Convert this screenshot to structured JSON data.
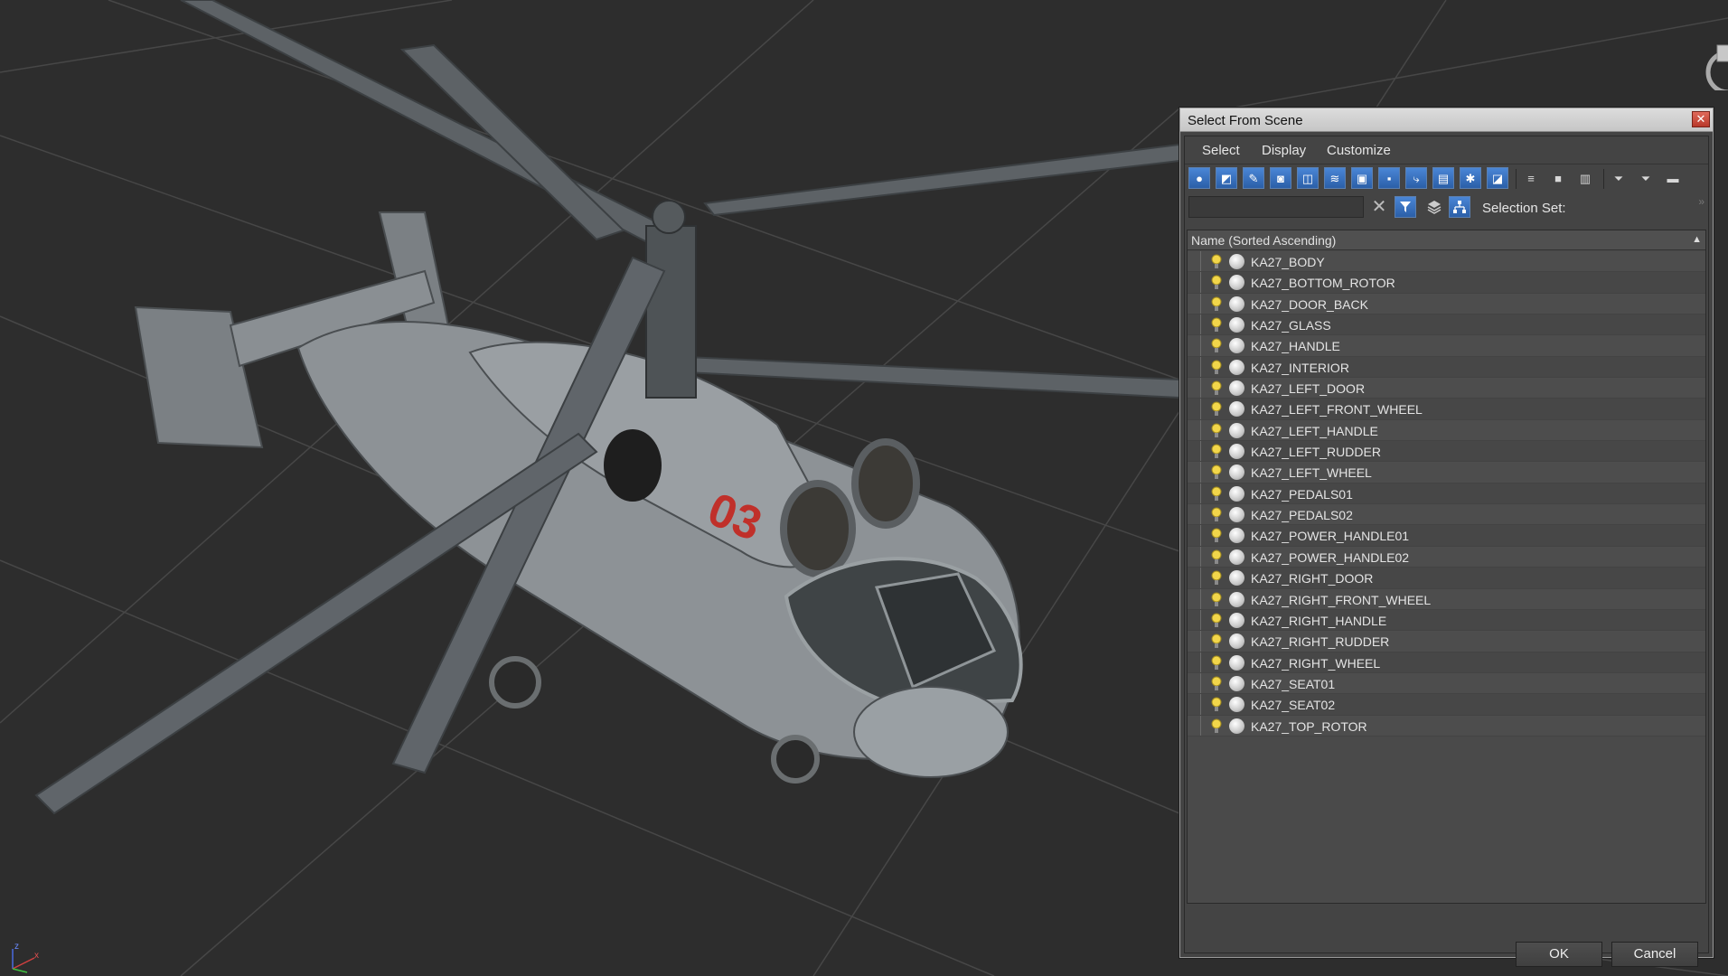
{
  "dialog": {
    "title": "Select From Scene",
    "close_glyph": "✕",
    "menu": [
      "Select",
      "Display",
      "Customize"
    ],
    "toolbar_icons": [
      "geometry-filter-icon",
      "shapes-filter-icon",
      "lights-filter-icon",
      "cameras-filter-icon",
      "helpers-filter-icon",
      "spacewarps-filter-icon",
      "groups-filter-icon",
      "xrefs-filter-icon",
      "bones-filter-icon",
      "containers-filter-icon",
      "frozen-filter-icon",
      "hidden-filter-icon",
      "select-all-icon",
      "select-none-icon",
      "select-invert-icon",
      "filter-icon",
      "filter-options-icon",
      "hierarchy-view-icon"
    ],
    "search_value": "",
    "clear_glyph": "✕",
    "selection_set_label": "Selection Set:",
    "more_glyph": "»",
    "list_header": "Name (Sorted Ascending)",
    "sort_glyph": "▲",
    "objects": [
      "KA27_BODY",
      "KA27_BOTTOM_ROTOR",
      "KA27_DOOR_BACK",
      "KA27_GLASS",
      "KA27_HANDLE",
      "KA27_INTERIOR",
      "KA27_LEFT_DOOR",
      "KA27_LEFT_FRONT_WHEEL",
      "KA27_LEFT_HANDLE",
      "KA27_LEFT_RUDDER",
      "KA27_LEFT_WHEEL",
      "KA27_PEDALS01",
      "KA27_PEDALS02",
      "KA27_POWER_HANDLE01",
      "KA27_POWER_HANDLE02",
      "KA27_RIGHT_DOOR",
      "KA27_RIGHT_FRONT_WHEEL",
      "KA27_RIGHT_HANDLE",
      "KA27_RIGHT_RUDDER",
      "KA27_RIGHT_WHEEL",
      "KA27_SEAT01",
      "KA27_SEAT02",
      "KA27_TOP_ROTOR"
    ],
    "ok_label": "OK",
    "cancel_label": "Cancel"
  },
  "viewport": {
    "fuselage_number": "03",
    "axis_labels": {
      "z": "z",
      "x": "x"
    }
  },
  "colors": {
    "viewport_bg": "#2d2d2d",
    "grid": "#4a4a4a",
    "helicopter_body": "#8a8f93",
    "rotor_blade": "#5f6468",
    "fuselage_number": "#c0302a",
    "toolbar_active": "#2f67b3"
  }
}
